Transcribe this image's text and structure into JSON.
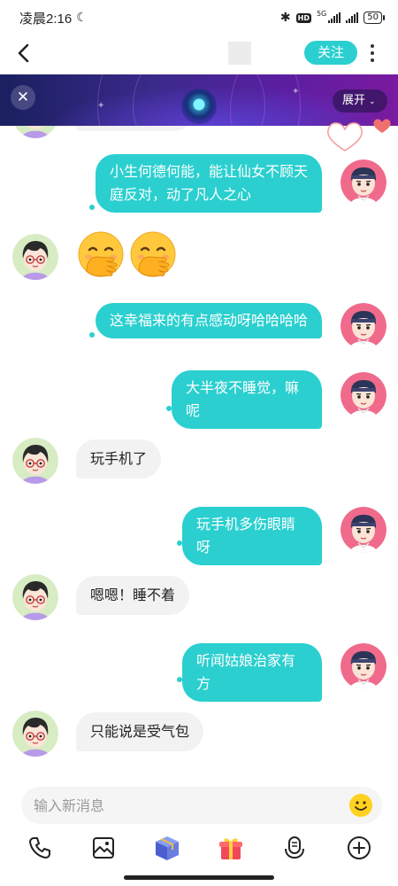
{
  "status_bar": {
    "time": "凌晨2:16",
    "hd": "HD",
    "network": "5G",
    "battery": "50"
  },
  "nav": {
    "follow_label": "关注"
  },
  "banner": {
    "expand_label": "展开"
  },
  "messages": [
    {
      "side": "out",
      "text": "小生何德何能，能让仙女不顾天庭反对，动了凡人之心"
    },
    {
      "side": "in",
      "type": "emoji",
      "emoji": "face-with-hand-over-mouth-icon",
      "count": 2
    },
    {
      "side": "out",
      "text": "这幸福来的有点感动呀哈哈哈哈"
    },
    {
      "side": "out",
      "text": "大半夜不睡觉，嘛呢"
    },
    {
      "side": "in",
      "text": "玩手机了"
    },
    {
      "side": "out",
      "text": "玩手机多伤眼睛呀"
    },
    {
      "side": "in",
      "text": "嗯嗯！睡不着"
    },
    {
      "side": "out",
      "text": "听闻姑娘治家有方"
    },
    {
      "side": "in",
      "text": "只能说是受气包"
    }
  ],
  "input": {
    "placeholder": "输入新消息"
  },
  "toolbar": [
    "phone-icon",
    "image-icon",
    "gift-box-icon",
    "gift-icon",
    "voice-icon",
    "add-icon"
  ],
  "colors": {
    "accent": "#2bcfcf",
    "incoming_bubble": "#f2f2f2",
    "banner_start": "#1a2060",
    "banner_end": "#7a1aa0"
  }
}
